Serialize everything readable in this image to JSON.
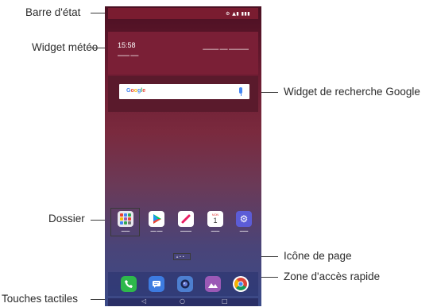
{
  "labels": {
    "status_bar": "Barre d'état",
    "weather_widget": "Widget météo",
    "folder": "Dossier",
    "soft_keys": "Touches tactiles",
    "google_search_widget": "Widget de recherche Google",
    "page_icon": "Icône de page",
    "quick_access": "Zone d'accès rapide"
  },
  "screen": {
    "weather": {
      "time": "15:58"
    },
    "search": {
      "logo": "Google"
    },
    "apps": [
      {
        "name": "folder",
        "icon": "folder-icon"
      },
      {
        "name": "play-store",
        "icon": "play-store-icon",
        "color": "#ffffff"
      },
      {
        "name": "quickmemo",
        "icon": "pencil-icon",
        "color": "#e91e63"
      },
      {
        "name": "calendar",
        "icon": "calendar-icon",
        "color": "#ffffff"
      },
      {
        "name": "settings",
        "icon": "gear-icon",
        "color": "#5c5cd6"
      }
    ],
    "calendar_day": "1",
    "calendar_month": "MON",
    "dock": [
      {
        "name": "phone",
        "icon": "phone-icon",
        "color": "#2eb84b"
      },
      {
        "name": "messages",
        "icon": "message-icon",
        "color": "#3d7be0"
      },
      {
        "name": "camera",
        "icon": "camera-icon",
        "color": "#4d7fd0"
      },
      {
        "name": "gallery",
        "icon": "gallery-icon",
        "color": "#9b59b6"
      },
      {
        "name": "chrome",
        "icon": "chrome-icon",
        "color": "#ffffff"
      }
    ],
    "nav_keys": [
      {
        "name": "back",
        "glyph": "◁"
      },
      {
        "name": "home",
        "glyph": "○"
      },
      {
        "name": "recents",
        "glyph": "□"
      }
    ]
  }
}
